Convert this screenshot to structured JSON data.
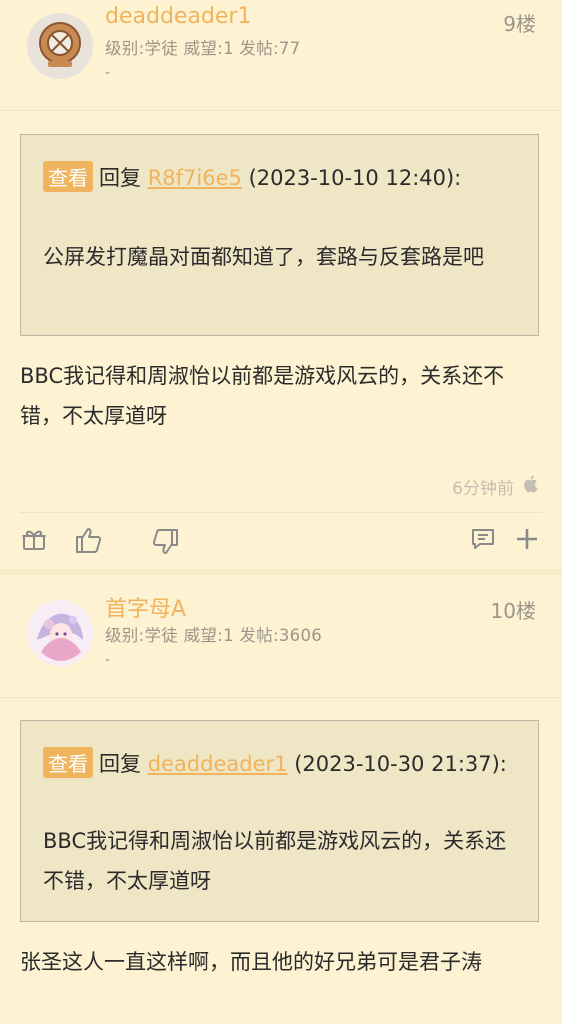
{
  "posts": [
    {
      "username": "deaddeader1",
      "userinfo": "级别:学徒 威望:1 发帖:77",
      "signature": "-",
      "floor": "9楼",
      "quote": {
        "view_label": "查看",
        "reply_prefix": "回复",
        "reply_user": "R8f7i6e5",
        "reply_time": "(2023-10-10 12:40):",
        "text": "公屏发打魔晶对面都知道了，套路与反套路是吧"
      },
      "content": "BBC我记得和周淑怡以前都是游戏风云的，关系还不错，不太厚道呀",
      "time": "6分钟前",
      "device_icon": "apple-icon"
    },
    {
      "username": "首字母A",
      "userinfo": "级别:学徒 威望:1 发帖:3606",
      "signature": "-",
      "floor": "10楼",
      "quote": {
        "view_label": "查看",
        "reply_prefix": "回复",
        "reply_user": "deaddeader1",
        "reply_time": "(2023-10-30 21:37):",
        "text": "BBC我记得和周淑怡以前都是游戏风云的，关系还不错，不太厚道呀"
      },
      "content": "张圣这人一直这样啊，而且他的好兄弟可是君子涛"
    }
  ],
  "actions": {
    "gift_icon": "gift-icon",
    "like_icon": "thumbs-up-icon",
    "dislike_icon": "thumbs-down-icon",
    "comment_icon": "comment-icon",
    "add_icon": "plus-icon"
  },
  "colors": {
    "background": "#fdf3d2",
    "accent": "#f0b35e",
    "muted": "#9c968a",
    "quote_bg": "#efe6c6"
  }
}
